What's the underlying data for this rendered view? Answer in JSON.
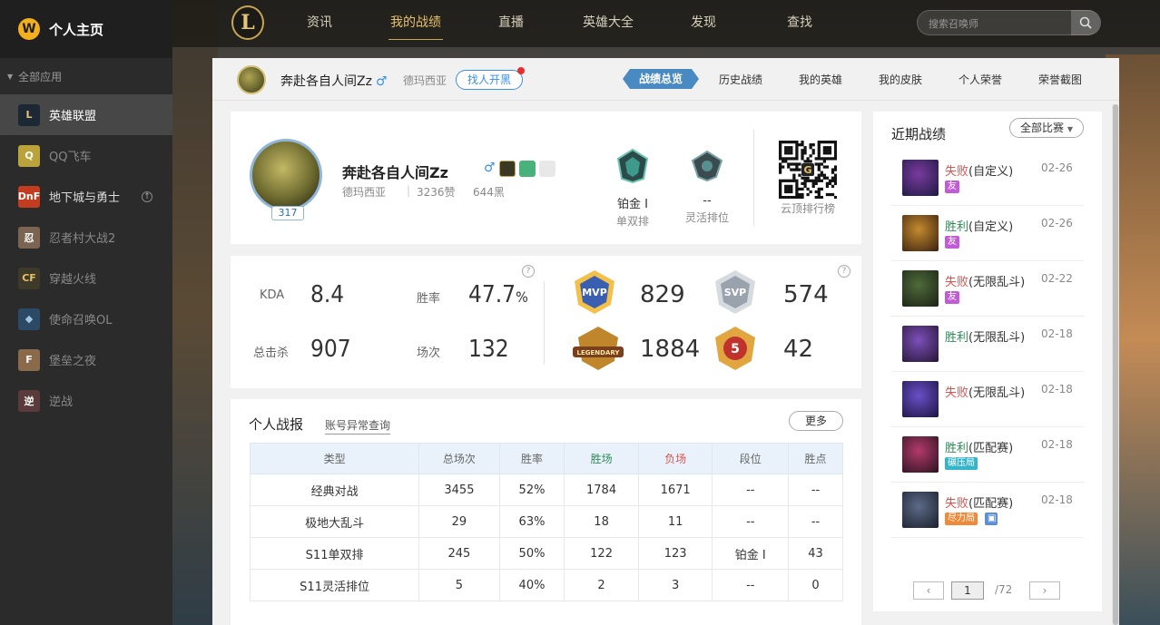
{
  "sidebar": {
    "title": "个人主页",
    "section": "全部应用",
    "items": [
      {
        "label": "英雄联盟",
        "icon": "L",
        "color": "#1c2833",
        "fg": "#e2c57b"
      },
      {
        "label": "QQ飞车",
        "icon": "Q",
        "color": "#b9a33a",
        "fg": "#fff"
      },
      {
        "label": "地下城与勇士",
        "icon": "DnF",
        "color": "#c43c1f",
        "fg": "#fff"
      },
      {
        "label": "忍者村大战2",
        "icon": "忍",
        "color": "#7b6552",
        "fg": "#fff"
      },
      {
        "label": "穿越火线",
        "icon": "CF",
        "color": "#3d3a2a",
        "fg": "#e6c06a"
      },
      {
        "label": "使命召唤OL",
        "icon": "◆",
        "color": "#2c4a66",
        "fg": "#9ec7e6"
      },
      {
        "label": "堡垒之夜",
        "icon": "F",
        "color": "#8a6a4a",
        "fg": "#fff"
      },
      {
        "label": "逆战",
        "icon": "逆",
        "color": "#5a3a3a",
        "fg": "#fff"
      }
    ]
  },
  "topnav": {
    "logo": "L",
    "items": [
      "资讯",
      "我的战绩",
      "直播",
      "英雄大全",
      "发现",
      "查找"
    ],
    "search_placeholder": "搜索召唤师"
  },
  "user": {
    "name": "奔赴各自人间Zz",
    "gender": "♂",
    "server": "德玛西亚",
    "find_label": "找人开黑",
    "tabs": [
      "战绩总览",
      "历史战绩",
      "我的英雄",
      "我的皮肤",
      "个人荣誉",
      "荣誉截图"
    ]
  },
  "profile": {
    "level": "317",
    "likes": "3236赞",
    "blacks": "644黑",
    "ranks": [
      {
        "tier": "铂金 Ⅰ",
        "queue": "单双排",
        "color": "#3e9a8a"
      },
      {
        "tier": "--",
        "queue": "灵活排位",
        "color": "#5a8f92"
      }
    ],
    "qr_label": "云顶排行榜",
    "qr_letter": "G"
  },
  "stats": {
    "kda_label": "KDA",
    "kda": "8.4",
    "winrate_label": "胜率",
    "winrate": "47.7",
    "winrate_unit": "%",
    "kills_label": "总击杀",
    "kills": "907",
    "games_label": "场次",
    "games": "132",
    "help": "?",
    "honors": [
      {
        "badge": "MVP",
        "value": "829",
        "color": "#3b5fb0"
      },
      {
        "badge": "SVP",
        "value": "574",
        "color": "#9aa3ad"
      },
      {
        "badge": "LEGENDARY",
        "value": "1884",
        "color": "#c0862c"
      },
      {
        "badge": "5",
        "value": "42",
        "color": "#c0322c"
      }
    ]
  },
  "report": {
    "title": "个人战报",
    "link": "账号异常查询",
    "more": "更多",
    "headers": [
      "类型",
      "总场次",
      "胜率",
      "胜场",
      "负场",
      "段位",
      "胜点"
    ],
    "rows": [
      [
        "经典对战",
        "3455",
        "52%",
        "1784",
        "1671",
        "--",
        "--"
      ],
      [
        "极地大乱斗",
        "29",
        "63%",
        "18",
        "11",
        "--",
        "--"
      ],
      [
        "S11单双排",
        "245",
        "50%",
        "122",
        "123",
        "铂金 Ⅰ",
        "43"
      ],
      [
        "S11灵活排位",
        "5",
        "40%",
        "2",
        "3",
        "--",
        "0"
      ]
    ]
  },
  "recent": {
    "title": "近期战绩",
    "filter": "全部比赛",
    "matches": [
      {
        "result": "失败",
        "mode": "(自定义)",
        "date": "02-26",
        "win": false,
        "tag": "友",
        "tagcolor": "#c35bd6",
        "c1": "#7a3aa0",
        "c2": "#1d1a40"
      },
      {
        "result": "胜利",
        "mode": "(自定义)",
        "date": "02-26",
        "win": true,
        "tag": "友",
        "tagcolor": "#c35bd6",
        "c1": "#c48a2e",
        "c2": "#3a2110"
      },
      {
        "result": "失败",
        "mode": "(无限乱斗)",
        "date": "02-22",
        "win": false,
        "tag": "友",
        "tagcolor": "#c35bd6",
        "c1": "#4f6a3a",
        "c2": "#1a2214"
      },
      {
        "result": "胜利",
        "mode": "(无限乱斗)",
        "date": "02-18",
        "win": true,
        "tag": "",
        "tagcolor": "",
        "c1": "#7d4fb8",
        "c2": "#241636"
      },
      {
        "result": "失败",
        "mode": "(无限乱斗)",
        "date": "02-18",
        "win": false,
        "tag": "",
        "tagcolor": "",
        "c1": "#6a4fc7",
        "c2": "#1b1540"
      },
      {
        "result": "胜利",
        "mode": "(匹配赛)",
        "date": "02-18",
        "win": true,
        "tag": "碾压局",
        "tagcolor": "#35b5c9",
        "c1": "#b23a6a",
        "c2": "#2a1220"
      },
      {
        "result": "失败",
        "mode": "(匹配赛)",
        "date": "02-18",
        "win": false,
        "tag": "尽力局",
        "tagcolor": "#f08a3a",
        "c1": "#5c6b88",
        "c2": "#1a1f2c"
      }
    ],
    "page": "1",
    "total": "/72"
  }
}
